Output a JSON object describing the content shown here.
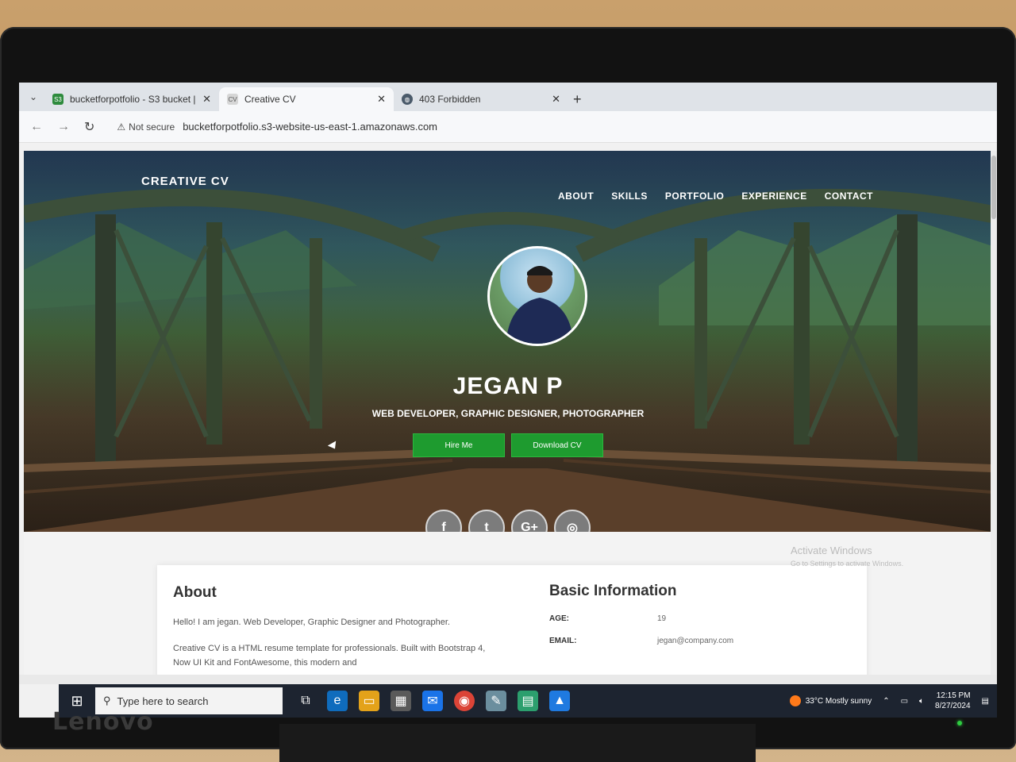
{
  "browser": {
    "tabs": [
      {
        "title": "bucketforpotfolio - S3 bucket |",
        "icon": "s3-bucket-icon",
        "active": false
      },
      {
        "title": "Creative CV",
        "icon": "cv-favicon-icon",
        "active": true
      },
      {
        "title": "403 Forbidden",
        "icon": "globe-icon",
        "active": false
      }
    ],
    "new_tab": "+",
    "security_label": "Not secure",
    "url": "bucketforpotfolio.s3-website-us-east-1.amazonaws.com"
  },
  "site": {
    "brand": "CREATIVE CV",
    "nav": [
      "ABOUT",
      "SKILLS",
      "PORTFOLIO",
      "EXPERIENCE",
      "CONTACT"
    ],
    "name": "JEGAN P",
    "tagline": "WEB DEVELOPER, GRAPHIC DESIGNER, PHOTOGRAPHER",
    "buttons": {
      "hire": "Hire Me",
      "download": "Download CV"
    },
    "socials": [
      "f",
      "t",
      "G+",
      "◎"
    ],
    "accent_color": "#1e9b2f"
  },
  "about": {
    "title": "About",
    "p1": "Hello! I am jegan. Web Developer, Graphic Designer and Photographer.",
    "p2": "Creative CV is a HTML resume template for professionals. Built with Bootstrap 4, Now UI Kit and FontAwesome, this modern and"
  },
  "basic_info": {
    "title": "Basic Information",
    "rows": [
      {
        "key": "AGE:",
        "value": "19"
      },
      {
        "key": "EMAIL:",
        "value": "jegan@company.com"
      }
    ]
  },
  "watermark": {
    "line1": "Activate Windows",
    "line2": "Go to Settings to activate Windows."
  },
  "taskbar": {
    "search_placeholder": "Type here to search",
    "weather": "33°C  Mostly sunny",
    "time": "12:15 PM",
    "date": "8/27/2024"
  },
  "monitor": {
    "brand": "Lenovo"
  }
}
